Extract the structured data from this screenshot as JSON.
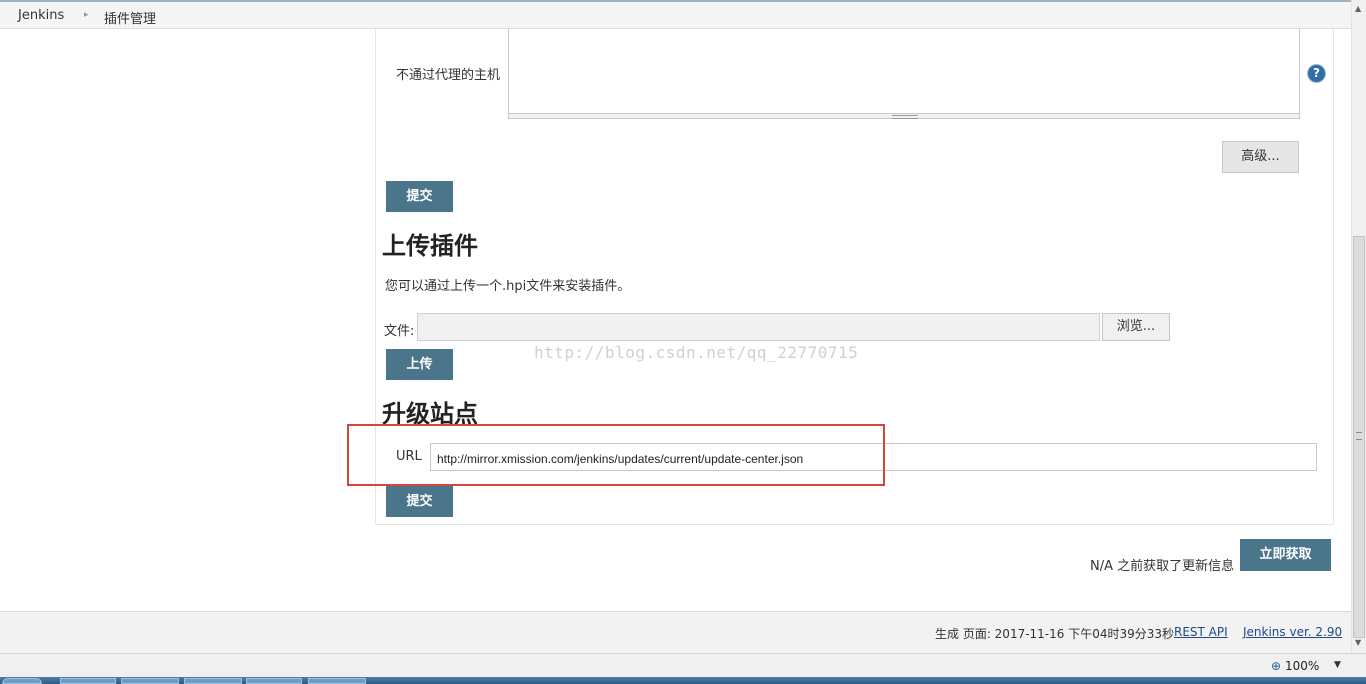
{
  "breadcrumb": {
    "items": [
      "Jenkins",
      "插件管理"
    ],
    "separator": "▸"
  },
  "proxy": {
    "no_proxy_label": "不通过代理的主机",
    "no_proxy_value": "",
    "help_glyph": "?",
    "advanced_button": "高级..."
  },
  "submit_label": "提交",
  "upload": {
    "title": "上传插件",
    "description": "您可以通过上传一个.hpi文件来安装插件。",
    "file_label": "文件:",
    "browse_button": "浏览...",
    "upload_button": "上传"
  },
  "watermark": "http://blog.csdn.net/qq_22770715",
  "update_site": {
    "title": "升级站点",
    "url_label": "URL",
    "url_value": "http://mirror.xmission.com/jenkins/updates/current/update-center.json",
    "submit_button": "提交"
  },
  "fetch": {
    "status_text": "N/A 之前获取了更新信息",
    "button": "立即获取"
  },
  "footer": {
    "generated": "生成 页面: 2017-11-16 下午04时39分33秒",
    "rest_api": "REST API",
    "version": "Jenkins ver. 2.90"
  },
  "status_bar": {
    "zoom": "100%"
  },
  "colors": {
    "primary_button": "#4b758b",
    "highlight": "#d9443a",
    "help_icon": "#2f6ea6",
    "link": "#204a87"
  }
}
